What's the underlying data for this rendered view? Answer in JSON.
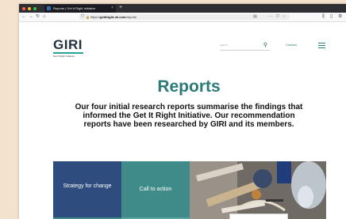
{
  "browser": {
    "tab_title": "Reports | Get It Right Initiative",
    "new_tab": "+",
    "tab_close": "×",
    "url_prefix": "https://",
    "url_domain": "getitright.uk.com",
    "url_path": "/reports",
    "nav": {
      "back": "←",
      "forward": "→",
      "reload": "↻",
      "home": "⌂"
    },
    "icons": {
      "shield": "⛉",
      "lock": "🔒",
      "reader": "▤",
      "more": "···",
      "pocket": "⛉",
      "star": "☆",
      "library": "⫼",
      "sidebar": "▯",
      "extensions": "⚙"
    }
  },
  "site": {
    "logo_text": "GIRI",
    "logo_sub": "Get It Right Initiative",
    "search_placeholder": "Search",
    "search_icon": "⚲",
    "contact_label": "Contact"
  },
  "main": {
    "title": "Reports",
    "intro": "Our four initial research reports summarise the findings that informed the Get It Right Initiative. Our recommendation reports have been researched by GIRI and its members."
  },
  "cards": [
    {
      "label": "Strategy for change"
    },
    {
      "label": "Call to action"
    }
  ],
  "colors": {
    "accent": "#2b7a77",
    "card_blue": "#2e4c7d",
    "card_teal": "#3f8b8a",
    "backdrop": "#f3e2cd"
  }
}
